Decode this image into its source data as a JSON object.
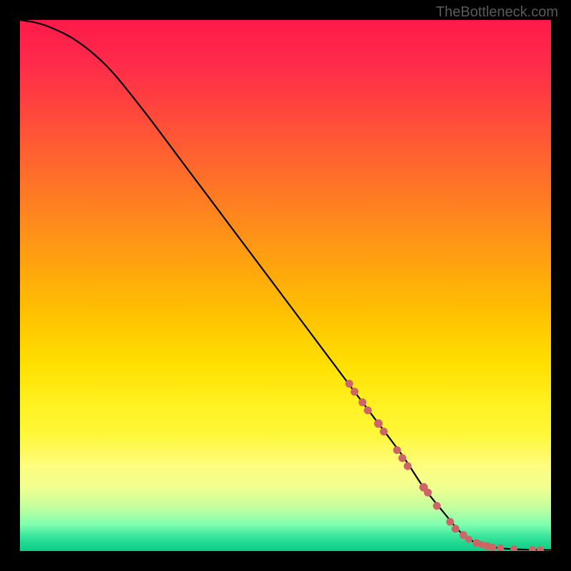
{
  "watermark": "TheBottleneck.com",
  "chart_data": {
    "type": "line",
    "title": "",
    "xlabel": "",
    "ylabel": "",
    "xlim": [
      0,
      100
    ],
    "ylim": [
      0,
      100
    ],
    "grid": false,
    "curve": {
      "x": [
        0,
        3,
        6,
        10,
        14,
        18,
        24,
        30,
        36,
        42,
        48,
        54,
        60,
        66,
        72,
        76,
        80,
        83,
        86,
        90,
        94,
        100
      ],
      "y": [
        100,
        99.5,
        98.5,
        96.5,
        93.5,
        89.5,
        82,
        74,
        66,
        58,
        50,
        42,
        34,
        26,
        18,
        12,
        7,
        3.5,
        1.5,
        0.6,
        0.3,
        0.2
      ]
    },
    "series": [
      {
        "name": "markers",
        "color": "#cc6666",
        "points": [
          {
            "x": 62,
            "y": 31.5,
            "r": 5.5
          },
          {
            "x": 63,
            "y": 30.0,
            "r": 5.5
          },
          {
            "x": 64.5,
            "y": 28.0,
            "r": 5.5
          },
          {
            "x": 65.5,
            "y": 26.5,
            "r": 5.5
          },
          {
            "x": 67.5,
            "y": 24.0,
            "r": 6.0
          },
          {
            "x": 68.5,
            "y": 22.5,
            "r": 5.5
          },
          {
            "x": 71.0,
            "y": 19.0,
            "r": 5.5
          },
          {
            "x": 72.0,
            "y": 17.5,
            "r": 5.5
          },
          {
            "x": 73.0,
            "y": 16.0,
            "r": 5.5
          },
          {
            "x": 76.0,
            "y": 12.0,
            "r": 6.0
          },
          {
            "x": 76.8,
            "y": 11.0,
            "r": 5.5
          },
          {
            "x": 78.5,
            "y": 8.5,
            "r": 5.5
          },
          {
            "x": 81.0,
            "y": 5.5,
            "r": 5.5
          },
          {
            "x": 82.0,
            "y": 4.2,
            "r": 5.5
          },
          {
            "x": 83.5,
            "y": 3.0,
            "r": 5.5
          },
          {
            "x": 84.5,
            "y": 2.2,
            "r": 5.0
          },
          {
            "x": 86.0,
            "y": 1.5,
            "r": 5.5
          },
          {
            "x": 87.0,
            "y": 1.2,
            "r": 5.0
          },
          {
            "x": 88.0,
            "y": 0.9,
            "r": 5.5
          },
          {
            "x": 89.0,
            "y": 0.7,
            "r": 5.0
          },
          {
            "x": 90.5,
            "y": 0.6,
            "r": 5.0
          },
          {
            "x": 93.0,
            "y": 0.4,
            "r": 5.0
          },
          {
            "x": 96.5,
            "y": 0.3,
            "r": 5.0
          },
          {
            "x": 98.0,
            "y": 0.25,
            "r": 5.0
          }
        ]
      }
    ]
  }
}
